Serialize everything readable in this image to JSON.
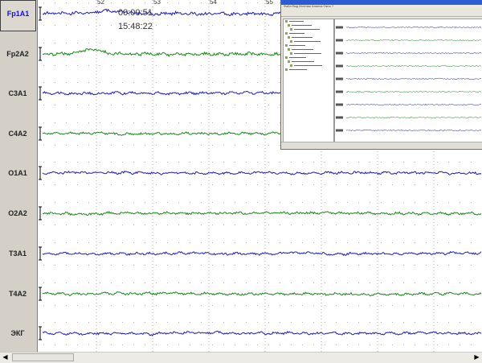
{
  "channels": [
    "Fp1A1",
    "Fp2A2",
    "C3A1",
    "C4A2",
    "O1A1",
    "O2A2",
    "T3A1",
    "T4A2",
    "ЭКГ"
  ],
  "selected_channel": "Fp1A1",
  "overlay": {
    "elapsed": "00:00:51",
    "clock": "15:48:22"
  },
  "ruler": {
    "numbers": [
      "52",
      "53",
      "54",
      "55"
    ]
  },
  "colors": {
    "blue": "#1a1ac8",
    "green": "#148a14",
    "grid": "#9a9a9a",
    "selected_label": "#1010ee"
  },
  "inset": {
    "title": "НейроСпектр - [EEG]",
    "menu": "Файл Вид Монтаж Анализ Окно ?"
  },
  "scrollbar": {
    "left_arrow": "◀",
    "right_arrow": "▶"
  }
}
